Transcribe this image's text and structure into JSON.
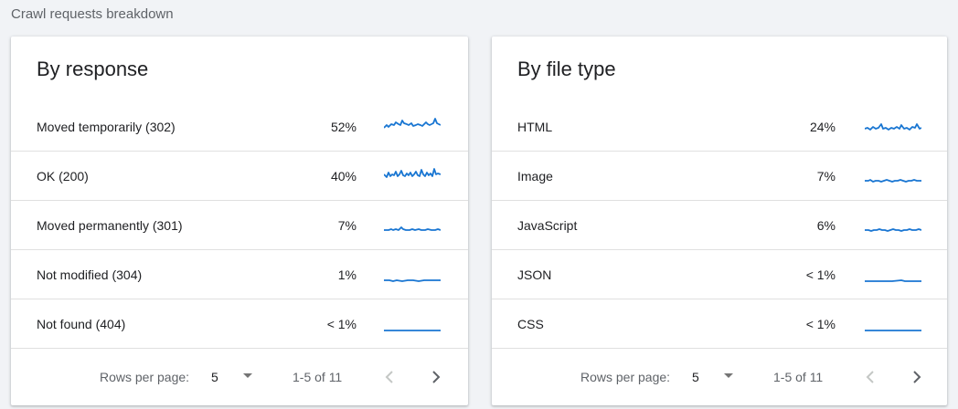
{
  "section_title": "Crawl requests breakdown",
  "colors": {
    "accent": "#1a73e8",
    "spark": "#1976d2"
  },
  "by_response": {
    "title": "By response",
    "rows": [
      {
        "label": "Moved temporarily (302)",
        "pct": "52%"
      },
      {
        "label": "OK (200)",
        "pct": "40%"
      },
      {
        "label": "Moved permanently (301)",
        "pct": "7%"
      },
      {
        "label": "Not modified (304)",
        "pct": "1%"
      },
      {
        "label": "Not found (404)",
        "pct": "< 1%"
      }
    ],
    "footer": {
      "rows_per_page_label": "Rows per page:",
      "rows_per_page_value": "5",
      "range": "1-5 of 11"
    }
  },
  "by_file_type": {
    "title": "By file type",
    "rows": [
      {
        "label": "HTML",
        "pct": "24%"
      },
      {
        "label": "Image",
        "pct": "7%"
      },
      {
        "label": "JavaScript",
        "pct": "6%"
      },
      {
        "label": "JSON",
        "pct": "< 1%"
      },
      {
        "label": "CSS",
        "pct": "< 1%"
      }
    ],
    "footer": {
      "rows_per_page_label": "Rows per page:",
      "rows_per_page_value": "5",
      "range": "1-5 of 11"
    }
  },
  "icons": {
    "dropdown": "arrow-drop-down-icon",
    "prev": "chevron-left-icon",
    "next": "chevron-right-icon"
  }
}
